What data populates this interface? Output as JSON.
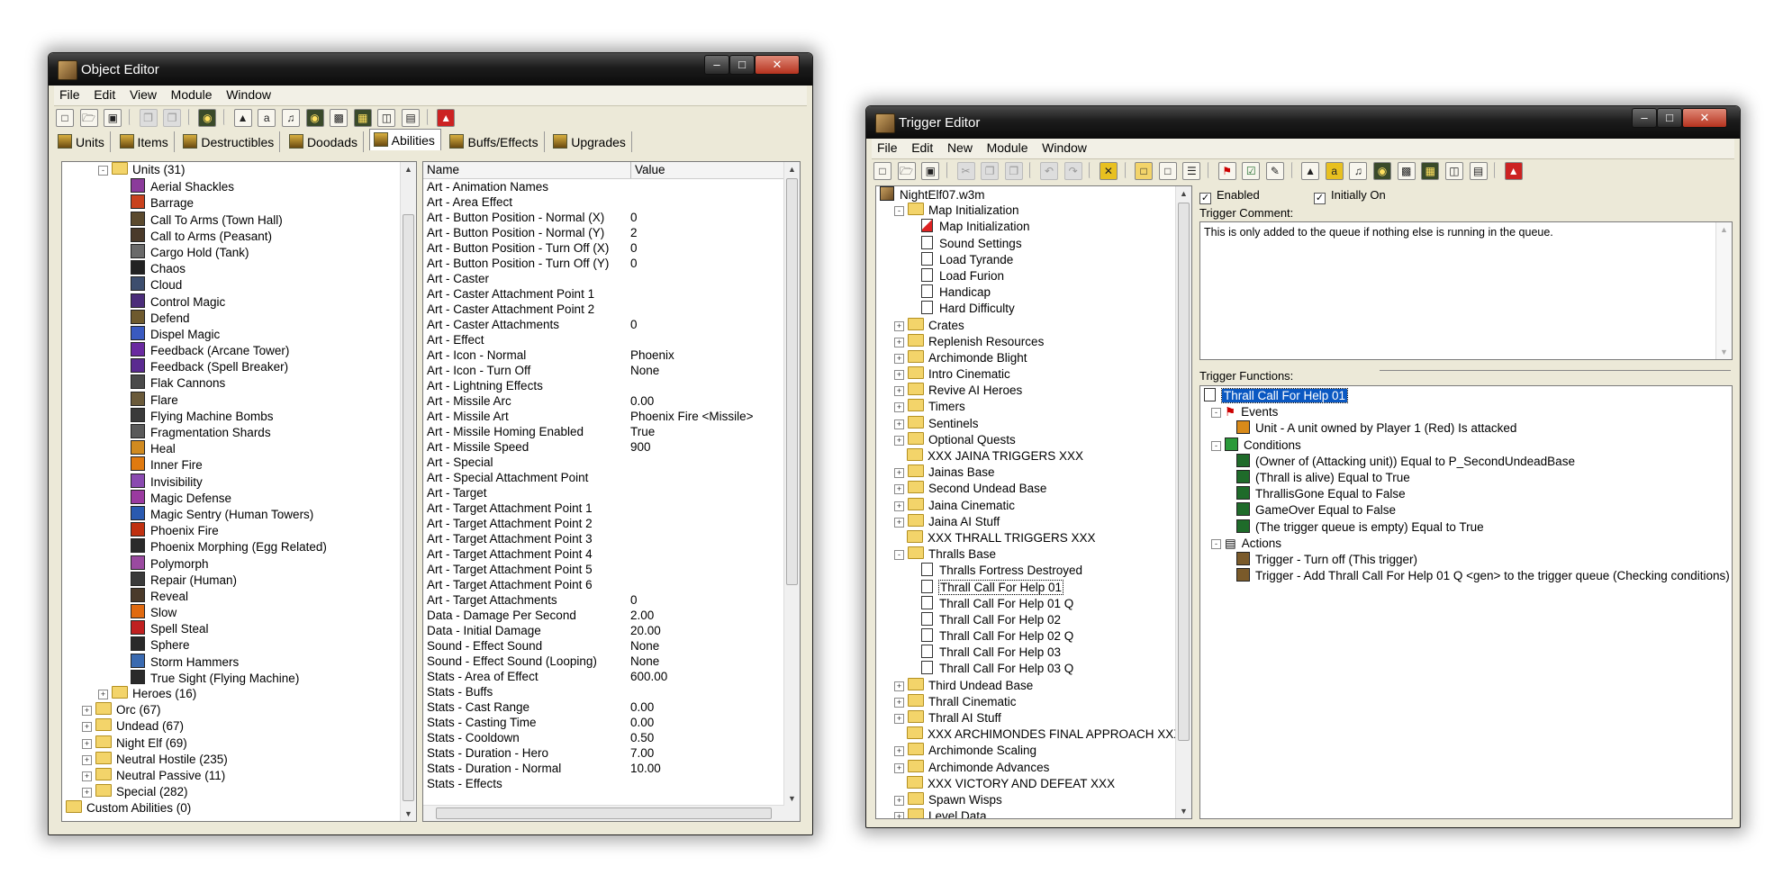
{
  "object_editor": {
    "title": "Object Editor",
    "menu": [
      "File",
      "Edit",
      "View",
      "Module",
      "Window"
    ],
    "tabs": [
      {
        "label": "Units",
        "active": false
      },
      {
        "label": "Items",
        "active": false
      },
      {
        "label": "Destructibles",
        "active": false
      },
      {
        "label": "Doodads",
        "active": false
      },
      {
        "label": "Abilities",
        "active": true
      },
      {
        "label": "Buffs/Effects",
        "active": false
      },
      {
        "label": "Upgrades",
        "active": false
      }
    ],
    "tree": [
      {
        "label": "Units (31)",
        "depth": 1,
        "type": "folder",
        "expand": "-"
      },
      {
        "label": "Aerial Shackles",
        "depth": 3,
        "type": "ability",
        "color": "#8b3b9b"
      },
      {
        "label": "Barrage",
        "depth": 3,
        "type": "ability",
        "color": "#c9421e"
      },
      {
        "label": "Call To Arms (Town Hall)",
        "depth": 3,
        "type": "ability",
        "color": "#5b4a2e"
      },
      {
        "label": "Call to Arms (Peasant)",
        "depth": 3,
        "type": "ability",
        "color": "#4a3a2a"
      },
      {
        "label": "Cargo Hold (Tank)",
        "depth": 3,
        "type": "ability",
        "color": "#6a6a6a"
      },
      {
        "label": "Chaos",
        "depth": 3,
        "type": "ability",
        "color": "#222222"
      },
      {
        "label": "Cloud",
        "depth": 3,
        "type": "ability",
        "color": "#3d4e6e"
      },
      {
        "label": "Control Magic",
        "depth": 3,
        "type": "ability",
        "color": "#4b2d7a"
      },
      {
        "label": "Defend",
        "depth": 3,
        "type": "ability",
        "color": "#6e5a2e"
      },
      {
        "label": "Dispel Magic",
        "depth": 3,
        "type": "ability",
        "color": "#3a5ac0"
      },
      {
        "label": "Feedback (Arcane Tower)",
        "depth": 3,
        "type": "ability",
        "color": "#6a2aa0"
      },
      {
        "label": "Feedback (Spell Breaker)",
        "depth": 3,
        "type": "ability",
        "color": "#5a2a90"
      },
      {
        "label": "Flak Cannons",
        "depth": 3,
        "type": "ability",
        "color": "#4a4a4a"
      },
      {
        "label": "Flare",
        "depth": 3,
        "type": "ability",
        "color": "#6a5a3a"
      },
      {
        "label": "Flying Machine Bombs",
        "depth": 3,
        "type": "ability",
        "color": "#3a3a3a"
      },
      {
        "label": "Fragmentation Shards",
        "depth": 3,
        "type": "ability",
        "color": "#5a5a5a"
      },
      {
        "label": "Heal",
        "depth": 3,
        "type": "ability",
        "color": "#d08a20"
      },
      {
        "label": "Inner Fire",
        "depth": 3,
        "type": "ability",
        "color": "#e07a10"
      },
      {
        "label": "Invisibility",
        "depth": 3,
        "type": "ability",
        "color": "#8a4ab0"
      },
      {
        "label": "Magic Defense",
        "depth": 3,
        "type": "ability",
        "color": "#9a3aa0"
      },
      {
        "label": "Magic Sentry (Human Towers)",
        "depth": 3,
        "type": "ability",
        "color": "#2a5ab0"
      },
      {
        "label": "Phoenix Fire",
        "depth": 3,
        "type": "ability",
        "color": "#c03010"
      },
      {
        "label": "Phoenix Morphing (Egg Related)",
        "depth": 3,
        "type": "ability",
        "color": "#2a2a2a"
      },
      {
        "label": "Polymorph",
        "depth": 3,
        "type": "ability",
        "color": "#9a4aa0"
      },
      {
        "label": "Repair (Human)",
        "depth": 3,
        "type": "ability",
        "color": "#3a3a3a"
      },
      {
        "label": "Reveal",
        "depth": 3,
        "type": "ability",
        "color": "#4a3a2a"
      },
      {
        "label": "Slow",
        "depth": 3,
        "type": "ability",
        "color": "#e06a10"
      },
      {
        "label": "Spell Steal",
        "depth": 3,
        "type": "ability",
        "color": "#c02020"
      },
      {
        "label": "Sphere",
        "depth": 3,
        "type": "ability",
        "color": "#2a2a2a"
      },
      {
        "label": "Storm Hammers",
        "depth": 3,
        "type": "ability",
        "color": "#3a6ab0"
      },
      {
        "label": "True Sight (Flying Machine)",
        "depth": 3,
        "type": "ability",
        "color": "#2a2a2a"
      },
      {
        "label": "Heroes (16)",
        "depth": 1,
        "type": "folder",
        "expand": "+"
      },
      {
        "label": "Orc (67)",
        "depth": 0,
        "type": "folder",
        "expand": "+"
      },
      {
        "label": "Undead (67)",
        "depth": 0,
        "type": "folder",
        "expand": "+"
      },
      {
        "label": "Night Elf (69)",
        "depth": 0,
        "type": "folder",
        "expand": "+"
      },
      {
        "label": "Neutral Hostile (235)",
        "depth": 0,
        "type": "folder",
        "expand": "+"
      },
      {
        "label": "Neutral Passive (11)",
        "depth": 0,
        "type": "folder",
        "expand": "+"
      },
      {
        "label": "Special (282)",
        "depth": 0,
        "type": "folder",
        "expand": "+"
      },
      {
        "label": "Custom Abilities (0)",
        "depth": -1,
        "type": "folder",
        "expand": ""
      }
    ],
    "grid_headers": {
      "name": "Name",
      "value": "Value"
    },
    "grid": [
      {
        "name": "Art - Animation Names",
        "value": ""
      },
      {
        "name": "Art - Area Effect",
        "value": ""
      },
      {
        "name": "Art - Button Position - Normal (X)",
        "value": "0"
      },
      {
        "name": "Art - Button Position - Normal (Y)",
        "value": "2"
      },
      {
        "name": "Art - Button Position - Turn Off (X)",
        "value": "0"
      },
      {
        "name": "Art - Button Position - Turn Off (Y)",
        "value": "0"
      },
      {
        "name": "Art - Caster",
        "value": ""
      },
      {
        "name": "Art - Caster Attachment Point 1",
        "value": ""
      },
      {
        "name": "Art - Caster Attachment Point 2",
        "value": ""
      },
      {
        "name": "Art - Caster Attachments",
        "value": "0"
      },
      {
        "name": "Art - Effect",
        "value": ""
      },
      {
        "name": "Art - Icon - Normal",
        "value": "Phoenix"
      },
      {
        "name": "Art - Icon - Turn Off",
        "value": "None"
      },
      {
        "name": "Art - Lightning Effects",
        "value": ""
      },
      {
        "name": "Art - Missile Arc",
        "value": "0.00"
      },
      {
        "name": "Art - Missile Art",
        "value": "Phoenix Fire <Missile>"
      },
      {
        "name": "Art - Missile Homing Enabled",
        "value": "True"
      },
      {
        "name": "Art - Missile Speed",
        "value": "900"
      },
      {
        "name": "Art - Special",
        "value": ""
      },
      {
        "name": "Art - Special Attachment Point",
        "value": ""
      },
      {
        "name": "Art - Target",
        "value": ""
      },
      {
        "name": "Art - Target Attachment Point 1",
        "value": ""
      },
      {
        "name": "Art - Target Attachment Point 2",
        "value": ""
      },
      {
        "name": "Art - Target Attachment Point 3",
        "value": ""
      },
      {
        "name": "Art - Target Attachment Point 4",
        "value": ""
      },
      {
        "name": "Art - Target Attachment Point 5",
        "value": ""
      },
      {
        "name": "Art - Target Attachment Point 6",
        "value": ""
      },
      {
        "name": "Art - Target Attachments",
        "value": "0"
      },
      {
        "name": "Data - Damage Per Second",
        "value": "2.00"
      },
      {
        "name": "Data - Initial Damage",
        "value": "20.00"
      },
      {
        "name": "Sound - Effect Sound",
        "value": "None"
      },
      {
        "name": "Sound - Effect Sound (Looping)",
        "value": "None"
      },
      {
        "name": "Stats - Area of Effect",
        "value": "600.00"
      },
      {
        "name": "Stats - Buffs",
        "value": ""
      },
      {
        "name": "Stats - Cast Range",
        "value": "0.00"
      },
      {
        "name": "Stats - Casting Time",
        "value": "0.00"
      },
      {
        "name": "Stats - Cooldown",
        "value": "0.50"
      },
      {
        "name": "Stats - Duration - Hero",
        "value": "7.00"
      },
      {
        "name": "Stats - Duration - Normal",
        "value": "10.00"
      },
      {
        "name": "Stats - Effects",
        "value": ""
      }
    ]
  },
  "trigger_editor": {
    "title": "Trigger Editor",
    "menu": [
      "File",
      "Edit",
      "New",
      "Module",
      "Window"
    ],
    "tree": [
      {
        "label": "NightElf07.w3m",
        "depth": 0,
        "type": "map",
        "expand": ""
      },
      {
        "label": "Map Initialization",
        "depth": 1,
        "type": "folder",
        "expand": "-"
      },
      {
        "label": "Map Initialization",
        "depth": 2,
        "type": "trigger-red",
        "expand": ""
      },
      {
        "label": "Sound Settings",
        "depth": 2,
        "type": "trigger",
        "expand": ""
      },
      {
        "label": "Load Tyrande",
        "depth": 2,
        "type": "trigger",
        "expand": ""
      },
      {
        "label": "Load Furion",
        "depth": 2,
        "type": "trigger",
        "expand": ""
      },
      {
        "label": "Handicap",
        "depth": 2,
        "type": "trigger",
        "expand": ""
      },
      {
        "label": "Hard Difficulty",
        "depth": 2,
        "type": "trigger",
        "expand": ""
      },
      {
        "label": "Crates",
        "depth": 1,
        "type": "folder",
        "expand": "+"
      },
      {
        "label": "Replenish Resources",
        "depth": 1,
        "type": "folder",
        "expand": "+"
      },
      {
        "label": "Archimonde Blight",
        "depth": 1,
        "type": "folder",
        "expand": "+"
      },
      {
        "label": "Intro Cinematic",
        "depth": 1,
        "type": "folder",
        "expand": "+"
      },
      {
        "label": "Revive AI Heroes",
        "depth": 1,
        "type": "folder",
        "expand": "+"
      },
      {
        "label": "Timers",
        "depth": 1,
        "type": "folder",
        "expand": "+"
      },
      {
        "label": "Sentinels",
        "depth": 1,
        "type": "folder",
        "expand": "+"
      },
      {
        "label": "Optional Quests",
        "depth": 1,
        "type": "folder",
        "expand": "+"
      },
      {
        "label": "XXX JAINA TRIGGERS XXX",
        "depth": 1,
        "type": "folder",
        "expand": ""
      },
      {
        "label": "Jainas Base",
        "depth": 1,
        "type": "folder",
        "expand": "+"
      },
      {
        "label": "Second Undead Base",
        "depth": 1,
        "type": "folder",
        "expand": "+"
      },
      {
        "label": "Jaina Cinematic",
        "depth": 1,
        "type": "folder",
        "expand": "+"
      },
      {
        "label": "Jaina AI Stuff",
        "depth": 1,
        "type": "folder",
        "expand": "+"
      },
      {
        "label": "XXX THRALL TRIGGERS XXX",
        "depth": 1,
        "type": "folder",
        "expand": ""
      },
      {
        "label": "Thralls Base",
        "depth": 1,
        "type": "folder",
        "expand": "-"
      },
      {
        "label": "Thralls Fortress Destroyed",
        "depth": 2,
        "type": "trigger",
        "expand": ""
      },
      {
        "label": "Thrall Call For Help 01",
        "depth": 2,
        "type": "trigger",
        "expand": "",
        "boxed": true
      },
      {
        "label": "Thrall Call For Help 01 Q",
        "depth": 2,
        "type": "trigger",
        "expand": ""
      },
      {
        "label": "Thrall Call For Help 02",
        "depth": 2,
        "type": "trigger",
        "expand": ""
      },
      {
        "label": "Thrall Call For Help 02 Q",
        "depth": 2,
        "type": "trigger",
        "expand": ""
      },
      {
        "label": "Thrall Call For Help 03",
        "depth": 2,
        "type": "trigger",
        "expand": ""
      },
      {
        "label": "Thrall Call For Help 03 Q",
        "depth": 2,
        "type": "trigger",
        "expand": ""
      },
      {
        "label": "Third Undead Base",
        "depth": 1,
        "type": "folder",
        "expand": "+"
      },
      {
        "label": "Thrall Cinematic",
        "depth": 1,
        "type": "folder",
        "expand": "+"
      },
      {
        "label": "Thrall AI Stuff",
        "depth": 1,
        "type": "folder",
        "expand": "+"
      },
      {
        "label": "XXX ARCHIMONDES FINAL APPROACH XXX",
        "depth": 1,
        "type": "folder",
        "expand": ""
      },
      {
        "label": "Archimonde Scaling",
        "depth": 1,
        "type": "folder",
        "expand": "+"
      },
      {
        "label": "Archimonde Advances",
        "depth": 1,
        "type": "folder",
        "expand": "+"
      },
      {
        "label": "XXX VICTORY AND DEFEAT XXX",
        "depth": 1,
        "type": "folder",
        "expand": ""
      },
      {
        "label": "Spawn Wisps",
        "depth": 1,
        "type": "folder",
        "expand": "+"
      },
      {
        "label": "Level Data",
        "depth": 1,
        "type": "folder",
        "expand": "+"
      }
    ],
    "enabled_label": "Enabled",
    "initially_on_label": "Initially On",
    "enabled": true,
    "initially_on": true,
    "comment_label": "Trigger Comment:",
    "comment": "This is only added to the queue if nothing else is running in the queue.",
    "functions_label": "Trigger Functions:",
    "functions": [
      {
        "label": "Thrall Call For Help 01",
        "depth": 0,
        "kind": "root",
        "selected": true
      },
      {
        "label": "Events",
        "depth": 1,
        "kind": "events"
      },
      {
        "label": "Unit - A unit owned by Player 1 (Red) Is attacked",
        "depth": 2,
        "kind": "event"
      },
      {
        "label": "Conditions",
        "depth": 1,
        "kind": "conditions"
      },
      {
        "label": "(Owner of (Attacking unit)) Equal to P_SecondUndeadBase",
        "depth": 2,
        "kind": "condition"
      },
      {
        "label": "(Thrall is alive) Equal to True",
        "depth": 2,
        "kind": "condition"
      },
      {
        "label": "ThrallisGone Equal to False",
        "depth": 2,
        "kind": "condition"
      },
      {
        "label": "GameOver Equal to False",
        "depth": 2,
        "kind": "condition"
      },
      {
        "label": "(The trigger queue is empty) Equal to True",
        "depth": 2,
        "kind": "condition"
      },
      {
        "label": "Actions",
        "depth": 1,
        "kind": "actions"
      },
      {
        "label": "Trigger - Turn off (This trigger)",
        "depth": 2,
        "kind": "action"
      },
      {
        "label": "Trigger - Add Thrall Call For Help 01 Q <gen> to the trigger queue (Checking conditions)",
        "depth": 2,
        "kind": "action"
      }
    ]
  }
}
